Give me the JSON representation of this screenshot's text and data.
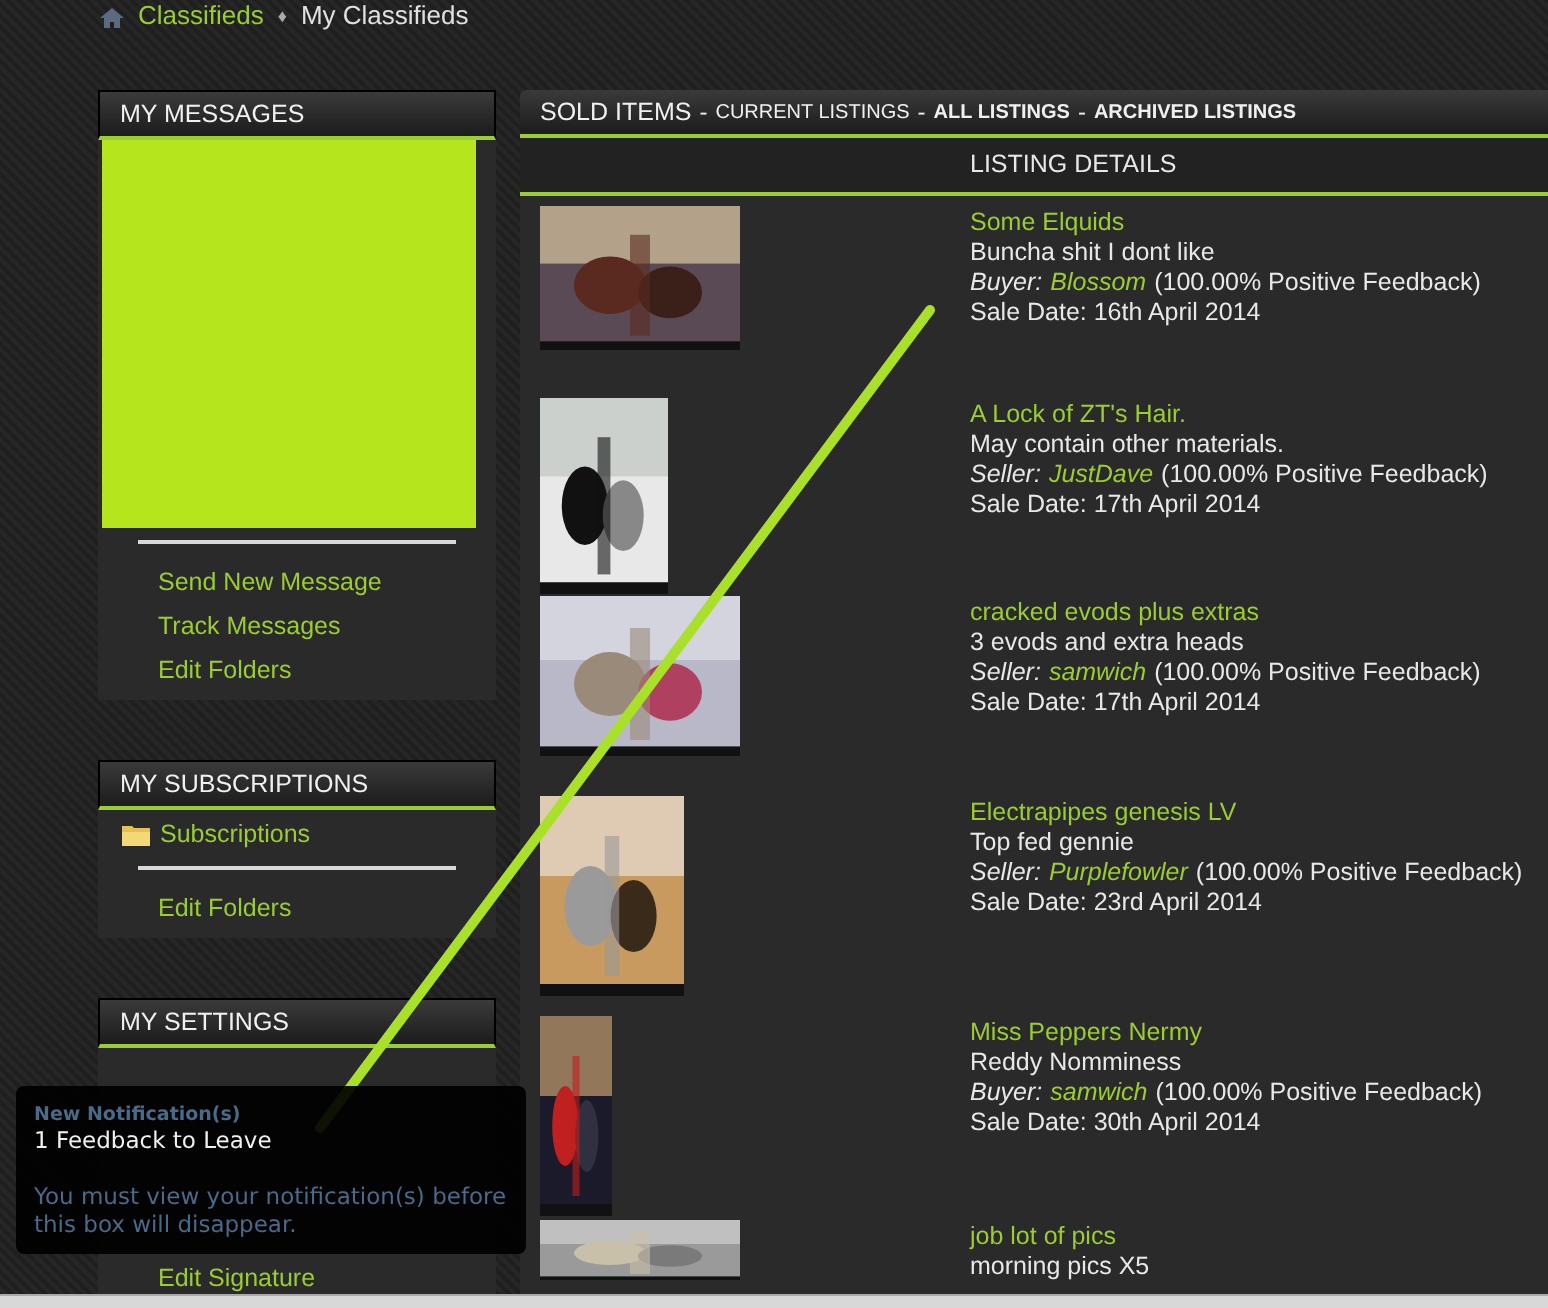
{
  "breadcrumb": {
    "items": [
      "Classifieds",
      "My Classifieds"
    ],
    "separator": "♦"
  },
  "sidebar": [
    {
      "title": "MY MESSAGES",
      "links": [
        {
          "kind": "banner"
        },
        {
          "kind": "divider"
        },
        {
          "label": "Send New Message",
          "kind": "link"
        },
        {
          "label": "Track Messages",
          "kind": "link"
        },
        {
          "label": "Edit Folders",
          "kind": "link"
        }
      ]
    },
    {
      "title": "MY SUBSCRIPTIONS",
      "links": [
        {
          "label": "Subscriptions",
          "kind": "folder"
        },
        {
          "kind": "divider"
        },
        {
          "label": "Edit Folders",
          "kind": "link"
        }
      ]
    },
    {
      "title": "MY SETTINGS",
      "links": [
        {
          "label": "Edit Signature",
          "kind": "hidden-gap"
        }
      ]
    }
  ],
  "listings_panel": {
    "tabs": [
      {
        "label": "SOLD ITEMS",
        "kind": "title"
      },
      {
        "label": "CURRENT LISTINGS",
        "kind": "small"
      },
      {
        "label": "ALL LISTINGS",
        "kind": "bold"
      },
      {
        "label": "ARCHIVED LISTINGS",
        "kind": "bold"
      }
    ],
    "separator": "-",
    "column_header": "LISTING DETAILS",
    "listings": [
      {
        "title": "Some Elquids",
        "description": "Buncha shit I dont like",
        "role": "Buyer:",
        "user": "Blossom",
        "feedback": "(100.00% Positive Feedback)",
        "date": "Sale Date: 16th April 2014"
      },
      {
        "title": "A Lock of ZT's Hair.",
        "description": "May contain other materials.",
        "role": "Seller:",
        "user": "JustDave",
        "feedback": "(100.00% Positive Feedback)",
        "date": "Sale Date: 17th April 2014"
      },
      {
        "title": "cracked evods plus extras",
        "description": "3 evods and extra heads",
        "role": "Seller:",
        "user": "samwich",
        "feedback": "(100.00% Positive Feedback)",
        "date": "Sale Date: 17th April 2014"
      },
      {
        "title": "Electrapipes genesis LV",
        "description": "Top fed gennie",
        "role": "Seller:",
        "user": "Purplefowler",
        "feedback": "(100.00% Positive Feedback)",
        "date": "Sale Date: 23rd April 2014"
      },
      {
        "title": "Miss Peppers Nermy",
        "description": "Reddy Nomminess",
        "role": "Buyer:",
        "user": "samwich",
        "feedback": "(100.00% Positive Feedback)",
        "date": "Sale Date: 30th April 2014"
      },
      {
        "title": "job lot of pics",
        "description": "morning pics X5"
      }
    ]
  },
  "notification": {
    "heading": "New Notification(s)",
    "message": "1 Feedback to Leave",
    "note": "You must view your notification(s) before this box will disappear."
  }
}
